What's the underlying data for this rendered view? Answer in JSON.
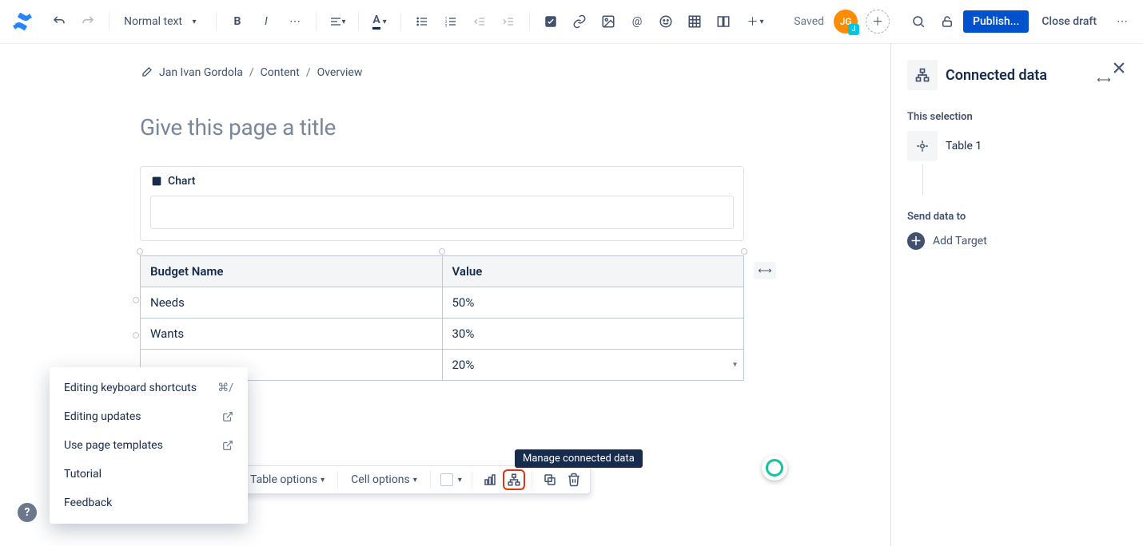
{
  "toolbar": {
    "text_style": "Normal text",
    "saved": "Saved",
    "avatar_initials": "JG",
    "avatar_badge": "J",
    "publish": "Publish...",
    "close_draft": "Close draft"
  },
  "breadcrumbs": {
    "items": [
      "Jan Ivan Gordola",
      "Content",
      "Overview"
    ]
  },
  "page": {
    "title_placeholder": "Give this page a title"
  },
  "chart_block": {
    "label": "Chart"
  },
  "table": {
    "headers": [
      "Budget Name",
      "Value"
    ],
    "rows": [
      {
        "name": "Needs",
        "value": "50%"
      },
      {
        "name": "Wants",
        "value": "30%"
      },
      {
        "name": "",
        "value": "20%"
      }
    ]
  },
  "float_toolbar": {
    "table_options": "Table options",
    "cell_options": "Cell options",
    "tooltip": "Manage connected data"
  },
  "help_menu": {
    "items": [
      {
        "label": "Editing keyboard shortcuts",
        "accel": "⌘/"
      },
      {
        "label": "Editing updates",
        "ext": true
      },
      {
        "label": "Use page templates",
        "ext": true
      },
      {
        "label": "Tutorial"
      },
      {
        "label": "Feedback"
      }
    ]
  },
  "side_panel": {
    "title": "Connected data",
    "section_selection": "This selection",
    "selection_item": "Table 1",
    "section_send": "Send data to",
    "add_target": "Add Target"
  }
}
